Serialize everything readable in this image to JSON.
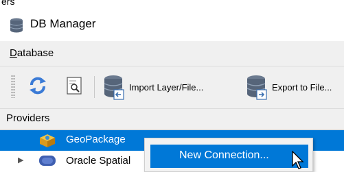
{
  "top_fragment": "ers",
  "window": {
    "title": "DB Manager",
    "icon": "database-icon"
  },
  "menubar": {
    "items": [
      {
        "label": "Database",
        "mnemonic": "D"
      }
    ]
  },
  "toolbar": {
    "refresh_icon": "refresh-icon",
    "sql_icon": "sql-window-icon",
    "import_label": "Import Layer/File...",
    "export_label": "Export to File..."
  },
  "providers": {
    "header": "Providers",
    "items": [
      {
        "label": "GeoPackage",
        "icon": "geopackage-icon",
        "selected": true
      },
      {
        "label": "Oracle Spatial",
        "icon": "oracle-icon",
        "selected": false
      }
    ]
  },
  "context_menu": {
    "items": [
      {
        "label": "New Connection...",
        "highlighted": true
      }
    ]
  },
  "colors": {
    "selection": "#0078d7",
    "toolbar_bg": "#f0f0f0"
  }
}
